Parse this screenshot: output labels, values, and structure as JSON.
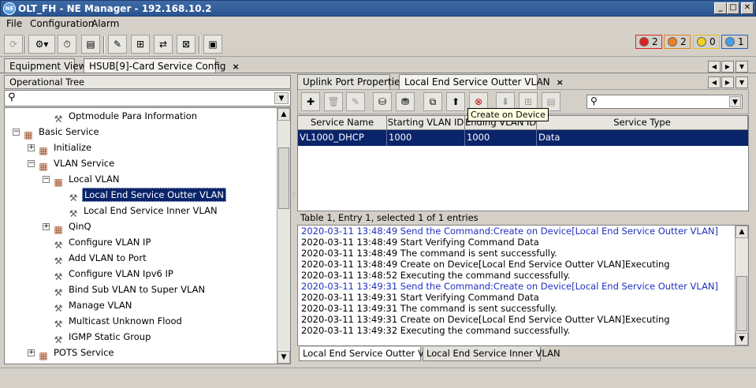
{
  "window": {
    "title": "OLT_FH - NE Manager - 192.168.10.2"
  },
  "menu": [
    "File",
    "Configuration",
    "Alarm"
  ],
  "alarms": [
    {
      "count": "2",
      "color": "#e02020",
      "border": "#e02020"
    },
    {
      "count": "2",
      "color": "#f08020",
      "border": "#e08020"
    },
    {
      "count": "0",
      "color": "#f0d020",
      "border": "#e0c020"
    },
    {
      "count": "1",
      "color": "#40a0f0",
      "border": "#2060c0"
    }
  ],
  "tabs": [
    {
      "label": "Equipment View",
      "closable": false
    },
    {
      "label": "HSUB[9]-Card Service Config",
      "closable": true
    }
  ],
  "tree": {
    "header": "Operational Tree",
    "items": [
      {
        "label": "Optmodule Para Information",
        "level": 2,
        "type": "wrench",
        "exp": ""
      },
      {
        "label": "Basic Service",
        "level": 0,
        "type": "folder",
        "exp": "-"
      },
      {
        "label": "Initialize",
        "level": 1,
        "type": "folder",
        "exp": "+"
      },
      {
        "label": "VLAN Service",
        "level": 1,
        "type": "folder",
        "exp": "-"
      },
      {
        "label": "Local VLAN",
        "level": 2,
        "type": "folder",
        "exp": "-"
      },
      {
        "label": "Local End Service Outter VLAN",
        "level": 3,
        "type": "wrench",
        "exp": "",
        "selected": true
      },
      {
        "label": "Local End Service Inner VLAN",
        "level": 3,
        "type": "wrench",
        "exp": ""
      },
      {
        "label": "QinQ",
        "level": 2,
        "type": "folder",
        "exp": "+"
      },
      {
        "label": "Configure VLAN IP",
        "level": 2,
        "type": "wrench",
        "exp": ""
      },
      {
        "label": "Add VLAN to Port",
        "level": 2,
        "type": "wrench",
        "exp": ""
      },
      {
        "label": "Configure VLAN Ipv6 IP",
        "level": 2,
        "type": "wrench",
        "exp": ""
      },
      {
        "label": "Bind Sub VLAN to Super VLAN",
        "level": 2,
        "type": "wrench",
        "exp": ""
      },
      {
        "label": "Manage VLAN",
        "level": 2,
        "type": "wrench",
        "exp": ""
      },
      {
        "label": "Multicast Unknown Flood",
        "level": 2,
        "type": "wrench",
        "exp": ""
      },
      {
        "label": "IGMP Static Group",
        "level": 2,
        "type": "wrench",
        "exp": ""
      },
      {
        "label": "POTS Service",
        "level": 1,
        "type": "folder",
        "exp": "+"
      }
    ]
  },
  "right_tabs": [
    {
      "label": "Uplink Port Properties",
      "closable": false
    },
    {
      "label": "Local End Service Outter VLAN",
      "closable": true
    }
  ],
  "tooltip": "Create on Device",
  "table": {
    "columns": [
      "Service Name",
      "Starting VLAN ID",
      "Ending VLAN ID",
      "Service Type"
    ],
    "rows": [
      [
        "VL1000_DHCP",
        "1000",
        "1000",
        "Data"
      ]
    ],
    "status": "Table 1, Entry 1, selected 1 of 1 entries"
  },
  "log": [
    {
      "text": "2020-03-11 13:48:49 Send the Command:Create on Device[Local End Service Outter VLAN]",
      "blue": true
    },
    {
      "text": "2020-03-11 13:48:49 Start Verifying Command Data",
      "blue": false
    },
    {
      "text": "2020-03-11 13:48:49 The command is sent successfully.",
      "blue": false
    },
    {
      "text": "2020-03-11 13:48:49 Create on Device[Local End Service Outter VLAN]Executing",
      "blue": false
    },
    {
      "text": "2020-03-11 13:48:52 Executing the command successfully.",
      "blue": false
    },
    {
      "text": "2020-03-11 13:49:31 Send the Command:Create on Device[Local End Service Outter VLAN]",
      "blue": true
    },
    {
      "text": "2020-03-11 13:49:31 Start Verifying Command Data",
      "blue": false
    },
    {
      "text": "2020-03-11 13:49:31 The command is sent successfully.",
      "blue": false
    },
    {
      "text": "2020-03-11 13:49:31 Create on Device[Local End Service Outter VLAN]Executing",
      "blue": false
    },
    {
      "text": "2020-03-11 13:49:32 Executing the command successfully.",
      "blue": false
    }
  ],
  "bottom_tabs": [
    "Local End Service Outter VLAN",
    "Local End Service Inner VLAN"
  ]
}
